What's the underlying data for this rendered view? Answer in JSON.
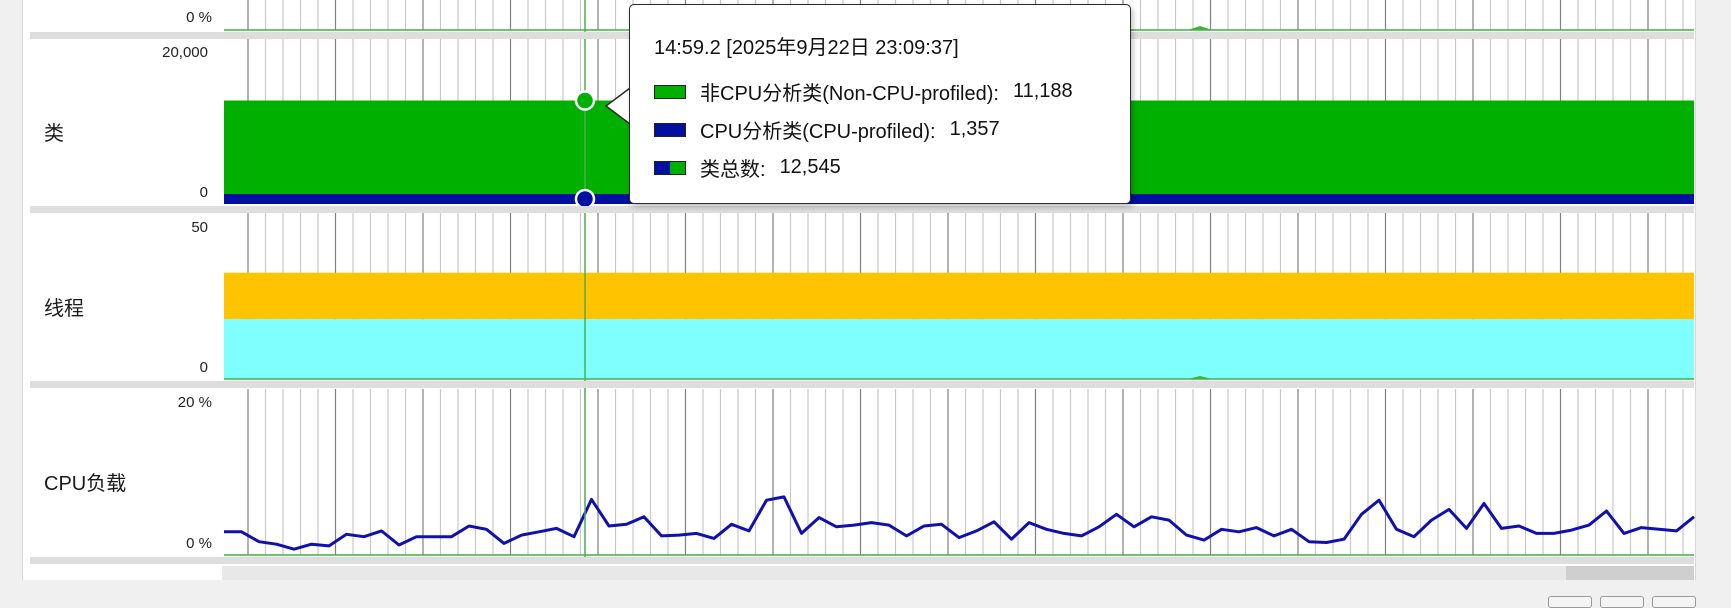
{
  "window": {
    "title": ""
  },
  "rows": {
    "top": {
      "axis_bottom": "0 %"
    },
    "classes": {
      "label": "类",
      "axis_top": "20,000",
      "axis_bottom": "0"
    },
    "threads": {
      "label": "线程",
      "axis_top": "50",
      "axis_bottom": "0"
    },
    "cpu": {
      "label": "CPU负载",
      "axis_top": "20 %",
      "axis_bottom": "0 %"
    }
  },
  "tooltip": {
    "title": "14:59.2 [2025年9月22日 23:09:37]",
    "items": [
      {
        "label": "非CPU分析类(Non-CPU-profiled):",
        "value": "11,188",
        "swatch": "green"
      },
      {
        "label": "CPU分析类(CPU-profiled):",
        "value": "1,357",
        "swatch": "blue"
      },
      {
        "label": "类总数:",
        "value": "12,545",
        "swatch": "mixed"
      }
    ]
  },
  "colors": {
    "non_cpu_classes": "#00b000",
    "cpu_classes": "#0010a0",
    "threads_upper": "#ffc300",
    "threads_lower": "#80ffff",
    "cpu_line": "#1010b0",
    "cursor_line": "#4caf50",
    "grid": "#9a9a9a",
    "baseline": "#3cb43c"
  },
  "chart_data": [
    {
      "type": "area",
      "name": "classes",
      "ylim": [
        0,
        20000
      ],
      "series": [
        {
          "name": "非CPU分析类(Non-CPU-profiled)",
          "values_const": 11188
        },
        {
          "name": "CPU分析类(CPU-profiled)",
          "values_const": 1357
        }
      ]
    },
    {
      "type": "area",
      "name": "threads",
      "ylim": [
        0,
        50
      ],
      "stacked_levels": [
        18,
        32
      ]
    },
    {
      "type": "line",
      "name": "cpu",
      "ylim": [
        0,
        20
      ],
      "values": [
        2.8,
        2.8,
        1.6,
        1.3,
        0.7,
        1.3,
        1.1,
        2.5,
        2.2,
        2.9,
        1.2,
        2.2,
        2.2,
        2.2,
        3.5,
        3.1,
        1.4,
        2.4,
        2.8,
        3.2,
        2.2,
        6.7,
        3.5,
        3.7,
        4.6,
        2.3,
        2.4,
        2.6,
        2.0,
        3.7,
        2.9,
        6.6,
        7.0,
        2.6,
        4.5,
        3.4,
        3.6,
        3.9,
        3.6,
        2.3,
        3.5,
        3.7,
        2.1,
        2.9,
        4.0,
        1.9,
        3.9,
        3.1,
        2.6,
        2.3,
        3.4,
        4.9,
        3.4,
        4.6,
        4.2,
        2.4,
        1.8,
        3.1,
        2.8,
        3.3,
        2.3,
        3.1,
        1.6,
        1.5,
        1.9,
        4.9,
        6.6,
        3.1,
        2.2,
        4.2,
        5.5,
        3.2,
        6.2,
        3.2,
        3.5,
        2.6,
        2.6,
        3.0,
        3.6,
        5.3,
        2.6,
        3.3,
        3.1,
        2.9,
        4.6
      ]
    }
  ]
}
